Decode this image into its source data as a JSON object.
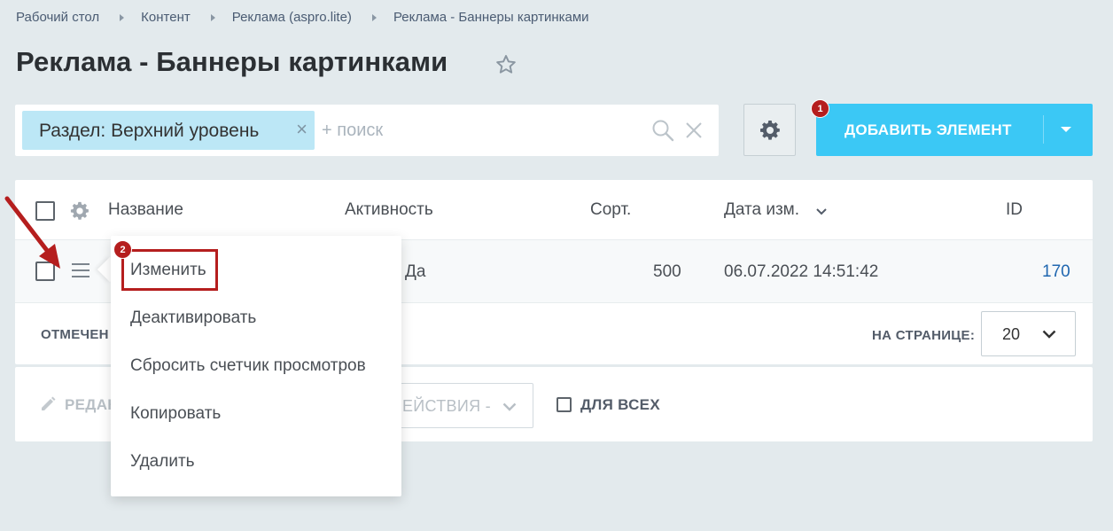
{
  "breadcrumb": [
    "Рабочий стол",
    "Контент",
    "Реклама (aspro.lite)",
    "Реклама - Баннеры картинками"
  ],
  "page_title": "Реклама - Баннеры картинками",
  "filter": {
    "chip_label": "Раздел: Верхний уровень",
    "search_placeholder": "+ поиск"
  },
  "add_button": {
    "label": "ДОБАВИТЬ ЭЛЕМЕНТ"
  },
  "markers": {
    "add": "1",
    "edit": "2"
  },
  "table": {
    "columns": {
      "name": "Название",
      "active": "Активность",
      "sort": "Сорт.",
      "date": "Дата изм.",
      "id": "ID"
    },
    "row": {
      "active": "Да",
      "sort": "500",
      "date": "06.07.2022 14:51:42",
      "id": "170"
    },
    "footer": {
      "selected_label": "ОТМЕЧЕН",
      "per_page_label": "НА СТРАНИЦЕ:",
      "per_page_value": "20"
    }
  },
  "actions": {
    "edit_label": "РЕДАК",
    "actions_select": "ЕЙСТВИЯ -",
    "for_all": "ДЛЯ ВСЕХ"
  },
  "context_menu": {
    "items": [
      "Изменить",
      "Деактивировать",
      "Сбросить счетчик просмотров",
      "Копировать",
      "Удалить"
    ]
  },
  "colors": {
    "accent": "#3bc8f5",
    "annotation": "#b51e1e",
    "link": "#2067b0",
    "background": "#e3eaed"
  }
}
